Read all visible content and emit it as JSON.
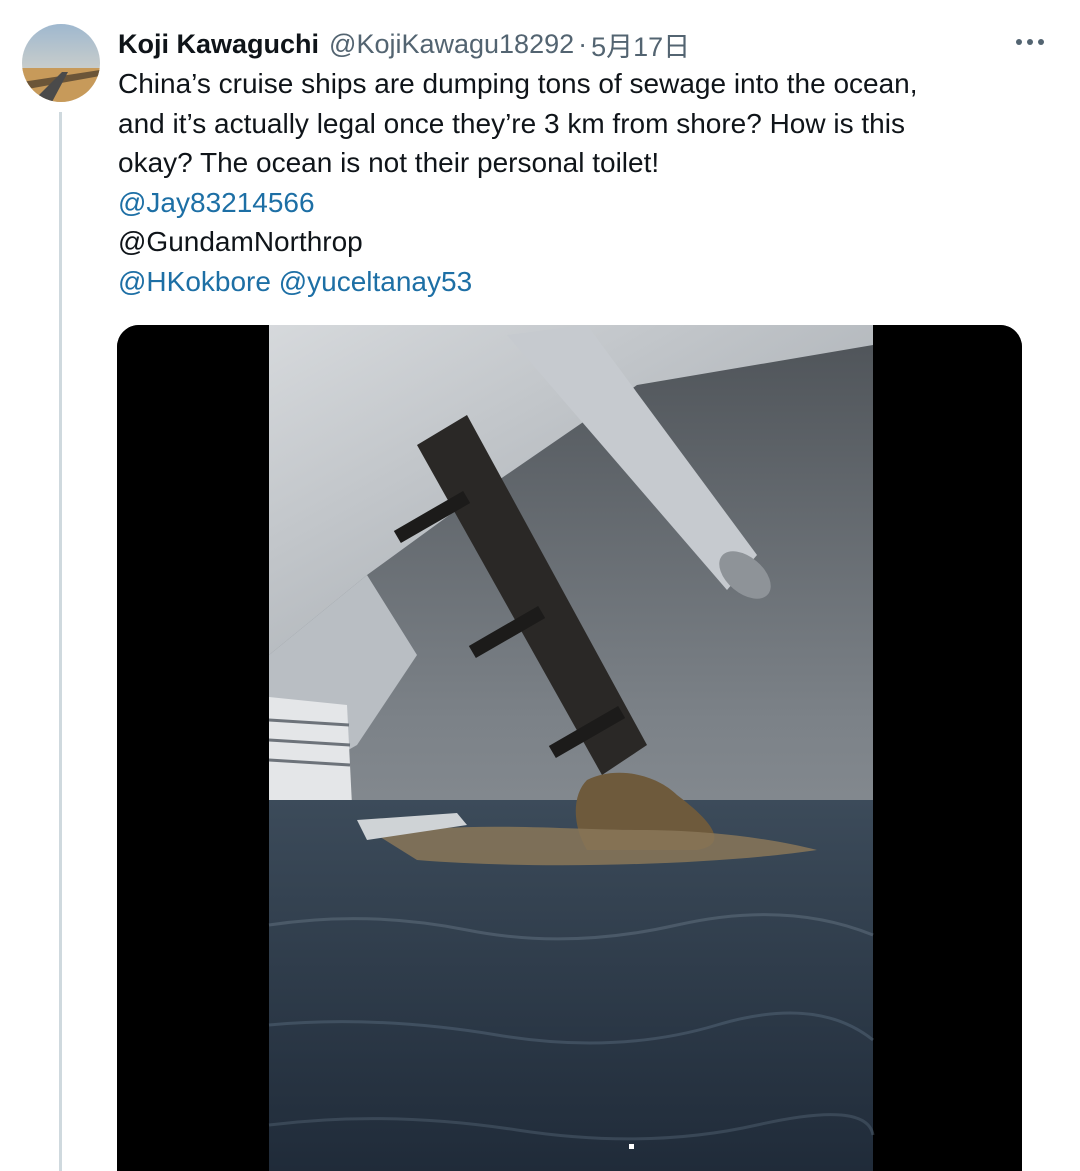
{
  "tweet": {
    "author_name": "Koji Kawaguchi",
    "handle": "@KojiKawagu18292",
    "separator": "·",
    "date": "5月17日",
    "more_icon": "more-horizontal-icon",
    "text_lines": [
      "China’s cruise ships are dumping tons of sewage into the ocean,",
      "and it’s actually legal once they’re 3 km from shore? How is this",
      "okay? The ocean is not their personal toilet!"
    ],
    "mentions": {
      "line1": "@Jay83214566",
      "line2": "@GundamNorthrop",
      "line3a": "@HKokbore",
      "line3b": "@yuceltanay53"
    }
  },
  "colors": {
    "text": "#0f1419",
    "muted": "#536471",
    "link": "#1d6fa5",
    "thread_line": "#cfd9de"
  }
}
